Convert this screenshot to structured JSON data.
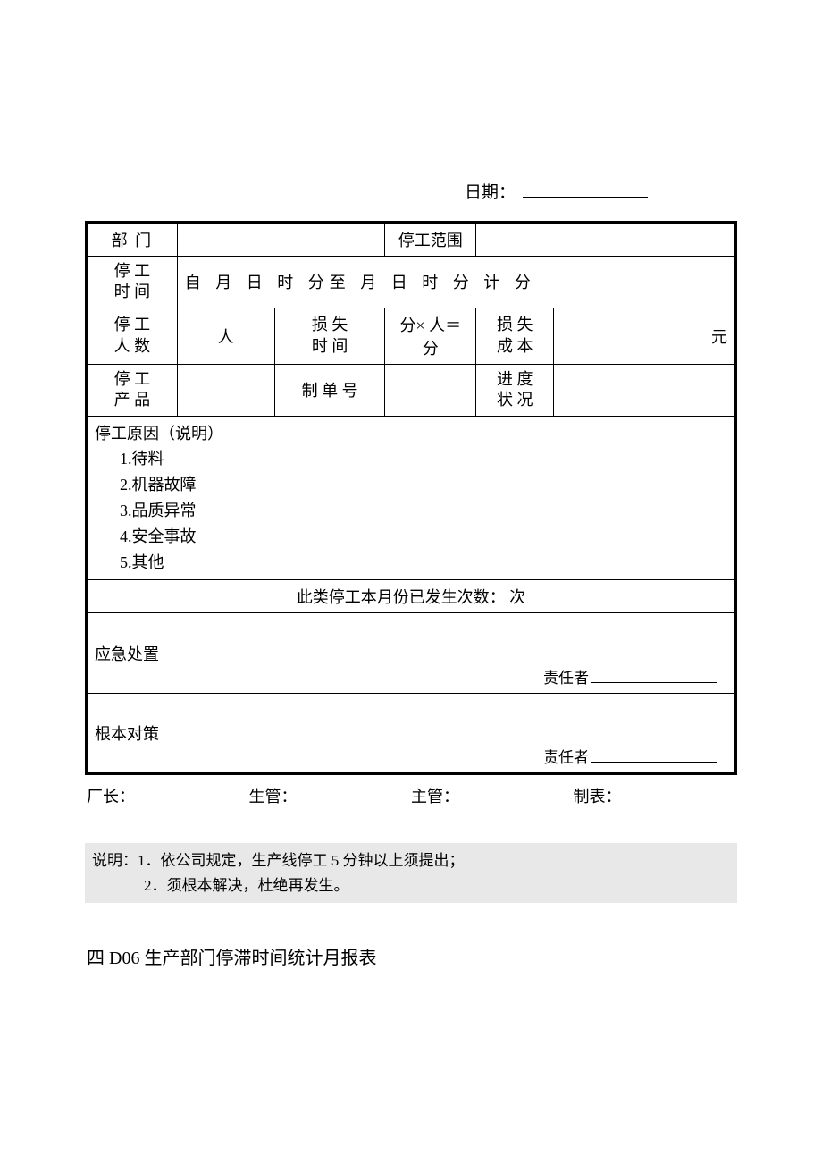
{
  "header": {
    "date_label": "日期："
  },
  "labels": {
    "department": "部 门",
    "stop_range": "停工范围",
    "stop_time": "停 工\n时 间",
    "stop_people": "停 工\n人 数",
    "loss_time": "损 失\n时 间",
    "loss_cost": "损 失\n成 本",
    "stop_product": "停 工\n产 品",
    "order_no": "制 单 号",
    "progress": "进 度\n状 况"
  },
  "time_row": "自  月  日  时  分至  月  日  时  分   计     分",
  "people_unit": "人",
  "loss_calc": "分× 人＝ 分",
  "cost_unit": "元",
  "reasons": {
    "title": "停工原因（说明）",
    "items": [
      "1.待料",
      "2.机器故障",
      "3.品质异常",
      "4.安全事故",
      "5.其他"
    ]
  },
  "monthly_count": "此类停工本月份已发生次数：       次",
  "emergency": {
    "label": "应急处置",
    "responsible": "责任者"
  },
  "root_cause": {
    "label": "根本对策",
    "responsible": "责任者"
  },
  "signatures": {
    "factory": "厂长：",
    "production": "生管：",
    "supervisor": "主管：",
    "preparer": "制表："
  },
  "notes": {
    "line1": "说明：1．依公司规定，生产线停工 5 分钟以上须提出；",
    "line2": "2．须根本解决，杜绝再发生。"
  },
  "next_title": "四 D06  生产部门停滞时间统计月报表"
}
